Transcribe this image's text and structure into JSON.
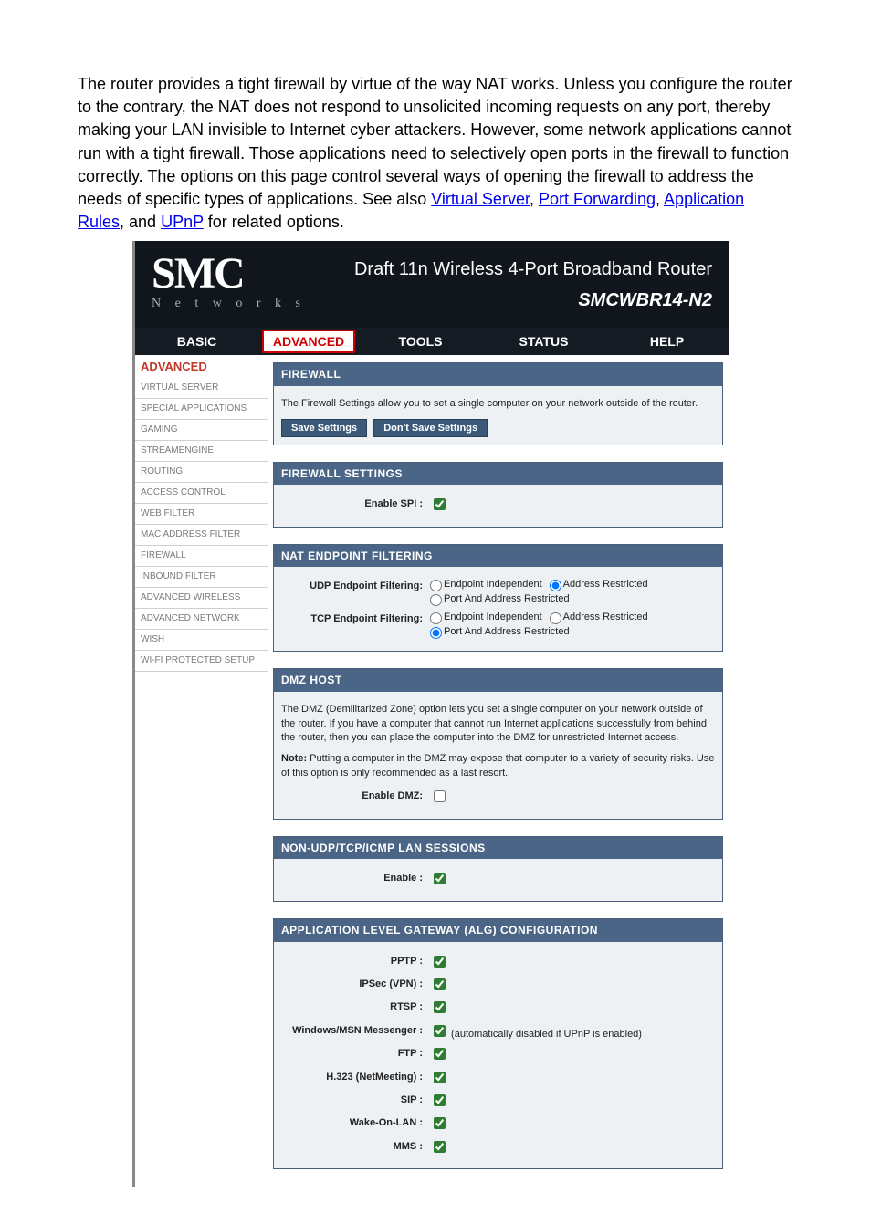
{
  "intro": {
    "text_before_links": "The router provides a tight firewall by virtue of the way NAT works. Unless you configure the router to the contrary, the NAT does not respond to unsolicited incoming requests on any port, thereby making your LAN invisible to Internet cyber attackers. However, some network applications cannot run with a tight firewall. Those applications need to selectively open ports in the firewall to function correctly. The options on this page control several ways of opening the firewall to address the needs of specific types of applications. See also ",
    "links": [
      "Virtual Server",
      "Port Forwarding",
      "Application Rules",
      "UPnP"
    ],
    "separators": [
      ", ",
      ", ",
      ", and "
    ],
    "text_after_links": " for related options."
  },
  "header": {
    "brand": "SMC",
    "brand_sub": "N e t w o r k s",
    "title": "Draft 11n Wireless 4-Port Broadband Router",
    "model": "SMCWBR14-N2"
  },
  "nav": {
    "items": [
      "BASIC",
      "ADVANCED",
      "TOOLS",
      "STATUS",
      "HELP"
    ],
    "active_index": 1
  },
  "sidebar": {
    "title": "ADVANCED",
    "items": [
      "VIRTUAL SERVER",
      "SPECIAL APPLICATIONS",
      "GAMING",
      "STREAMENGINE",
      "ROUTING",
      "ACCESS CONTROL",
      "WEB FILTER",
      "MAC ADDRESS FILTER",
      "FIREWALL",
      "INBOUND FILTER",
      "ADVANCED WIRELESS",
      "ADVANCED NETWORK",
      "WISH",
      "WI-FI PROTECTED SETUP"
    ]
  },
  "firewall_panel": {
    "title": "FIREWALL",
    "desc": "The Firewall Settings allow you to set a single computer on your network outside of the router.",
    "save_btn": "Save Settings",
    "dont_save_btn": "Don't Save Settings"
  },
  "firewall_settings": {
    "title": "FIREWALL SETTINGS",
    "enable_spi_label": "Enable SPI :",
    "enable_spi": true
  },
  "nat": {
    "title": "NAT ENDPOINT FILTERING",
    "udp_label": "UDP Endpoint Filtering:",
    "tcp_label": "TCP Endpoint Filtering:",
    "options": [
      "Endpoint Independent",
      "Address Restricted",
      "Port And Address Restricted"
    ],
    "udp_selected": 1,
    "tcp_selected": 2
  },
  "dmz": {
    "title": "DMZ HOST",
    "desc": "The DMZ (Demilitarized Zone) option lets you set a single computer on your network outside of the router. If you have a computer that cannot run Internet applications successfully from behind the router, then you can place the computer into the DMZ for unrestricted Internet access.",
    "note_label": "Note:",
    "note": " Putting a computer in the DMZ may expose that computer to a variety of security risks. Use of this option is only recommended as a last resort.",
    "enable_label": "Enable DMZ:",
    "enable": false
  },
  "nonudp": {
    "title": "NON-UDP/TCP/ICMP LAN SESSIONS",
    "enable_label": "Enable :",
    "enable": true
  },
  "alg": {
    "title": "APPLICATION LEVEL GATEWAY (ALG) CONFIGURATION",
    "rows": [
      {
        "label": "PPTP :",
        "checked": true,
        "extra": ""
      },
      {
        "label": "IPSec (VPN) :",
        "checked": true,
        "extra": ""
      },
      {
        "label": "RTSP :",
        "checked": true,
        "extra": ""
      },
      {
        "label": "Windows/MSN Messenger :",
        "checked": true,
        "extra": "(automatically disabled if UPnP is enabled)"
      },
      {
        "label": "FTP :",
        "checked": true,
        "extra": ""
      },
      {
        "label": "H.323 (NetMeeting) :",
        "checked": true,
        "extra": ""
      },
      {
        "label": "SIP :",
        "checked": true,
        "extra": ""
      },
      {
        "label": "Wake-On-LAN :",
        "checked": true,
        "extra": ""
      },
      {
        "label": "MMS :",
        "checked": true,
        "extra": ""
      }
    ]
  }
}
